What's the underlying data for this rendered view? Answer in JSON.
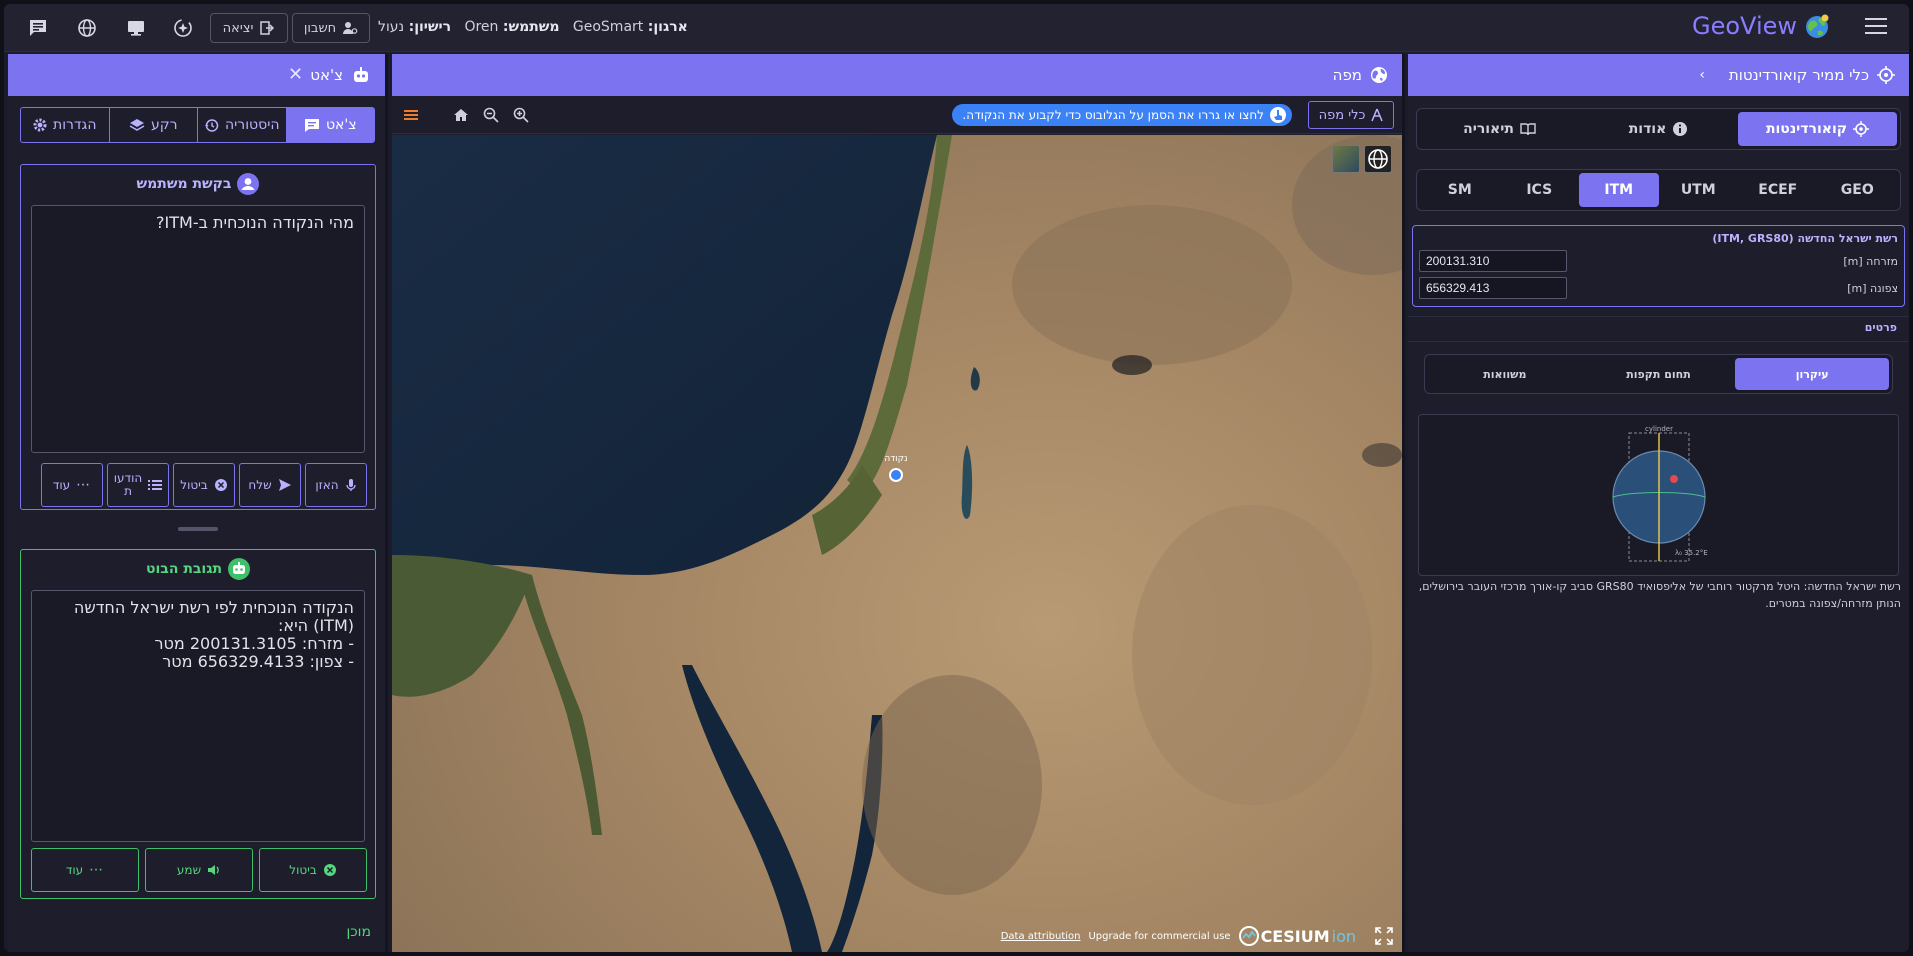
{
  "topbar": {
    "logo": "GeoView",
    "org_label": "ארגון:",
    "org_value": "GeoSmart",
    "user_label": "משתמש:",
    "user_value": "Oren",
    "license_label": "רישיון:",
    "license_value": "נעול",
    "account_btn": "חשבון",
    "logout_btn": "יציאה"
  },
  "chat": {
    "title": "צ'אט",
    "tabs": {
      "chat": "צ'אט",
      "history": "היסטוריה",
      "background": "רקע",
      "settings": "הגדרות"
    },
    "user_request": {
      "title": "בקשת משתמש",
      "text": "מהי הנקודה הנוכחית ב-ITM?",
      "buttons": {
        "listen": "האזן",
        "send": "שלח",
        "cancel": "ביטול",
        "messages_l1": "הודעו",
        "messages_l2": "ת",
        "more": "עוד"
      }
    },
    "bot_response": {
      "title": "תגובת הבוט",
      "text": "הנקודה הנוכחית לפי רשת ישראל החדשה (ITM) היא:\n- מזרח: 200131.3105 מטר\n- צפון: 656329.4133 מטר",
      "buttons": {
        "cancel": "ביטול",
        "hear": "שמע",
        "more": "עוד"
      }
    },
    "status": "מוכן"
  },
  "map": {
    "title": "מפה",
    "tools_btn": "כלי מפה",
    "hint": "לחצו או גררו את הסמן על הגלובוס כדי לקבוע את הנקודה.",
    "marker_label": "נקודה",
    "attribution": "Data attribution",
    "upgrade": "Upgrade for commercial use",
    "cesium_brand": "CESIUM",
    "cesium_suffix": "ion"
  },
  "converter": {
    "title": "כלי ממיר קואורדינטות",
    "main_tabs": {
      "coordinates": "קואורדינטות",
      "about": "אודות",
      "theory": "תיאוריה"
    },
    "systems": [
      "GEO",
      "ECEF",
      "UTM",
      "ITM",
      "ICS",
      "SM"
    ],
    "active_system": "ITM",
    "itm": {
      "title": "רשת ישראל החדשה (ITM, GRS80)",
      "east_label": "מזרחה [m]",
      "east_value": "200131.310",
      "north_label": "צפונה [m]",
      "north_value": "656329.413"
    },
    "details_label": "פרטים",
    "detail_tabs": {
      "principle": "עיקרון",
      "validity": "תחום תקפות",
      "equations": "משוואות"
    },
    "diagram": {
      "cylinder": "cylinder",
      "meridian": "λ₀ 35.2°E"
    },
    "description": "רשת ישראל החדשה: היטל מרקטור רוחבי של אליפסואיד GRS80 סביב קו-אורך מרכזי העובר בירושלים, הנותן מזרחה/צפונה במטרים."
  },
  "colors": {
    "accent": "#7c73f0",
    "success": "#3fbf6a",
    "hint_blue": "#3b82f6",
    "marker_red": "#e24b4b"
  }
}
